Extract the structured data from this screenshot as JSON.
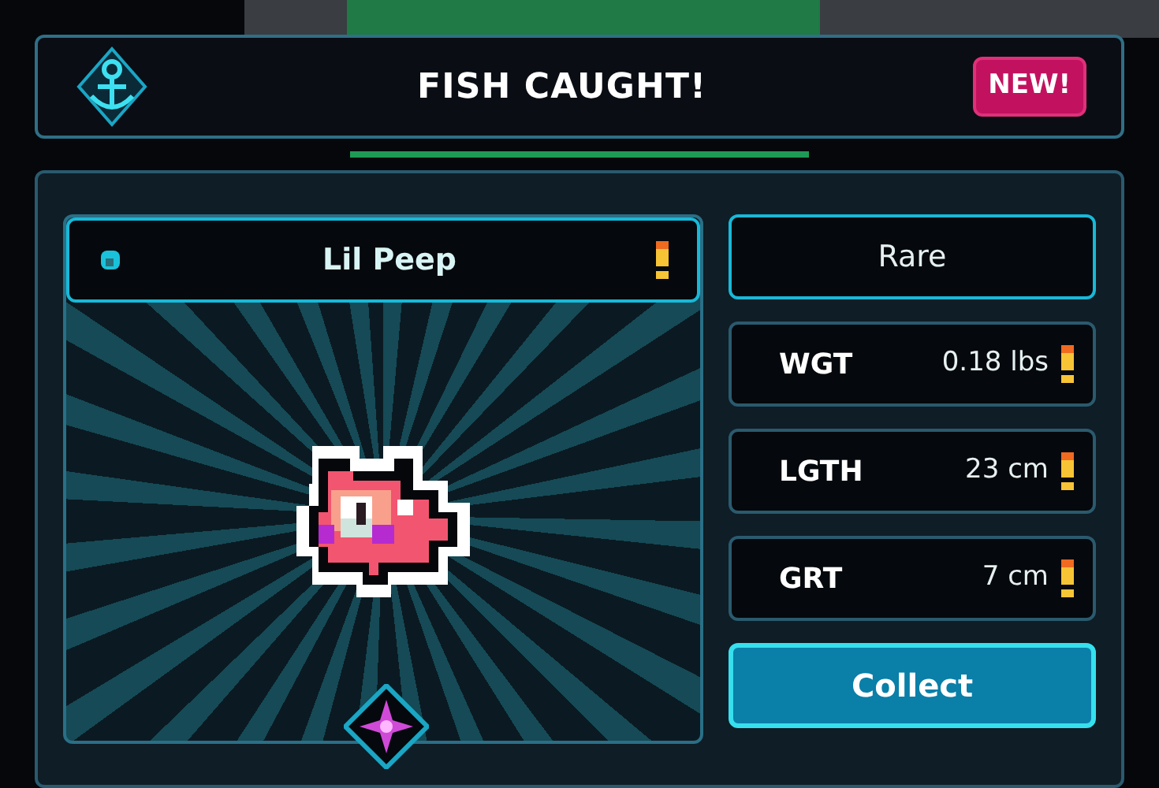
{
  "header": {
    "title": "FISH CAUGHT!",
    "badge": "NEW!"
  },
  "fish": {
    "name": "Lil Peep"
  },
  "rarity": "Rare",
  "stats": [
    {
      "label": "WGT",
      "value": "0.18 lbs"
    },
    {
      "label": "LGTH",
      "value": "23 cm"
    },
    {
      "label": "GRT",
      "value": "7 cm"
    }
  ],
  "action": {
    "label": "Collect"
  }
}
